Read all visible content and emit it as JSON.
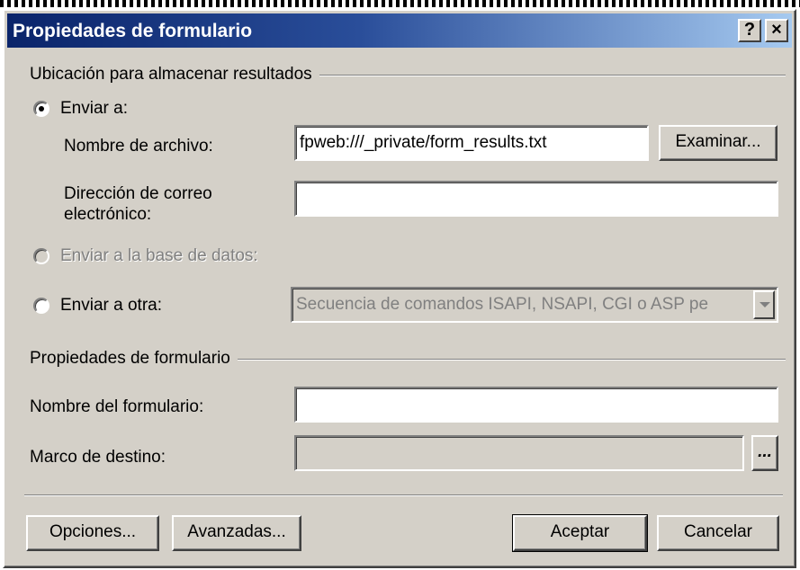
{
  "window": {
    "title": "Propiedades de formulario",
    "help_label": "?",
    "close_label": "×"
  },
  "results_group": {
    "label": "Ubicación para almacenar resultados",
    "send_to_label": "Enviar a:",
    "file_name_label": "Nombre de archivo:",
    "file_name_value": "fpweb:///_private/form_results.txt",
    "browse_label": "Examinar...",
    "email_label_line1": "Dirección de correo",
    "email_label_line2": "electrónico:",
    "email_value": "",
    "send_db_label": "Enviar a la base de datos:",
    "send_other_label": "Enviar a otra:",
    "other_select_value": "Secuencia de comandos ISAPI, NSAPI, CGI o ASP pe"
  },
  "form_group": {
    "label": "Propiedades de formulario",
    "form_name_label": "Nombre del formulario:",
    "form_name_value": "",
    "target_frame_label": "Marco de destino:",
    "target_frame_value": "",
    "target_frame_button": "..."
  },
  "footer": {
    "options_label": "Opciones...",
    "advanced_label": "Avanzadas...",
    "ok_label": "Aceptar",
    "cancel_label": "Cancelar"
  }
}
